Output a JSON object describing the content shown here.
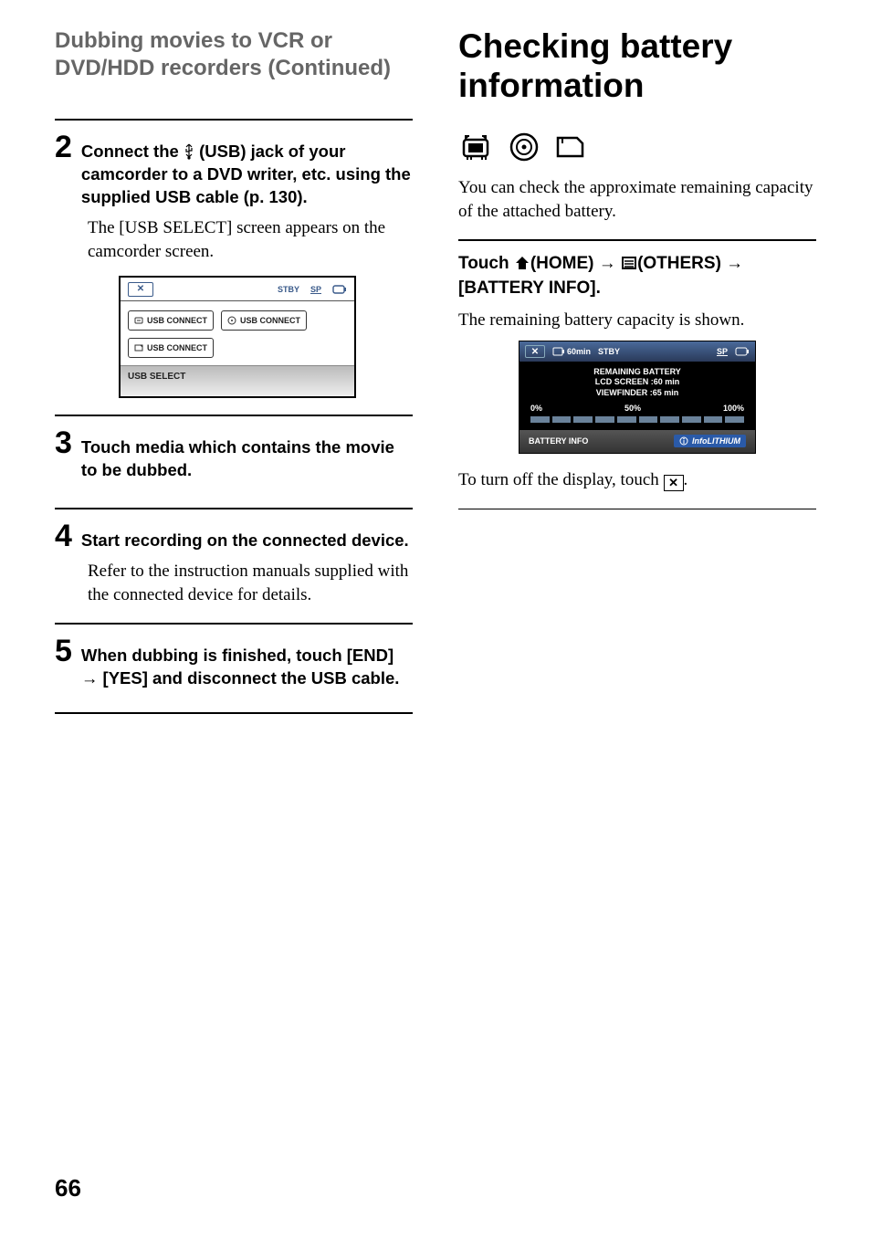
{
  "page_number": "66",
  "left": {
    "continuation_title": "Dubbing movies to VCR or DVD/HDD recorders (Continued)",
    "steps": [
      {
        "num": "2",
        "title_parts": [
          "Connect the ",
          " (USB) jack of your camcorder to a DVD writer, etc. using the supplied USB cable (p. 130)."
        ],
        "body": "The [USB SELECT] screen appears on the camcorder screen."
      },
      {
        "num": "3",
        "title": "Touch media which contains the movie to be dubbed."
      },
      {
        "num": "4",
        "title": "Start recording on the connected device.",
        "body": "Refer to the instruction manuals supplied with the connected device for details."
      },
      {
        "num": "5",
        "title": "When dubbing is finished, touch [END] → [YES] and disconnect the USB cable."
      }
    ],
    "usb_figure": {
      "status": "STBY",
      "sp": "SP",
      "buttons": [
        "USB CONNECT",
        "USB CONNECT",
        "USB CONNECT"
      ],
      "label": "USB SELECT"
    }
  },
  "right": {
    "heading": "Checking battery information",
    "intro": "You can check the approximate remaining capacity of the attached battery.",
    "touch_parts": {
      "p1": "Touch ",
      "home": "(HOME)",
      "arrow": " → ",
      "others": "(OTHERS)",
      "p2": " → [BATTERY INFO]."
    },
    "shown_text": "The remaining battery capacity is shown.",
    "battery_figure": {
      "time": "60min",
      "status": "STBY",
      "sp": "SP",
      "title": "REMAINING BATTERY",
      "lcd": "LCD SCREEN :60 min",
      "vf": "VIEWFINDER :65 min",
      "scale": [
        "0%",
        "50%",
        "100%"
      ],
      "label": "BATTERY INFO",
      "brand": "InfoLITHIUM"
    },
    "close_text_pre": "To turn off the display, touch ",
    "close_text_post": "."
  }
}
